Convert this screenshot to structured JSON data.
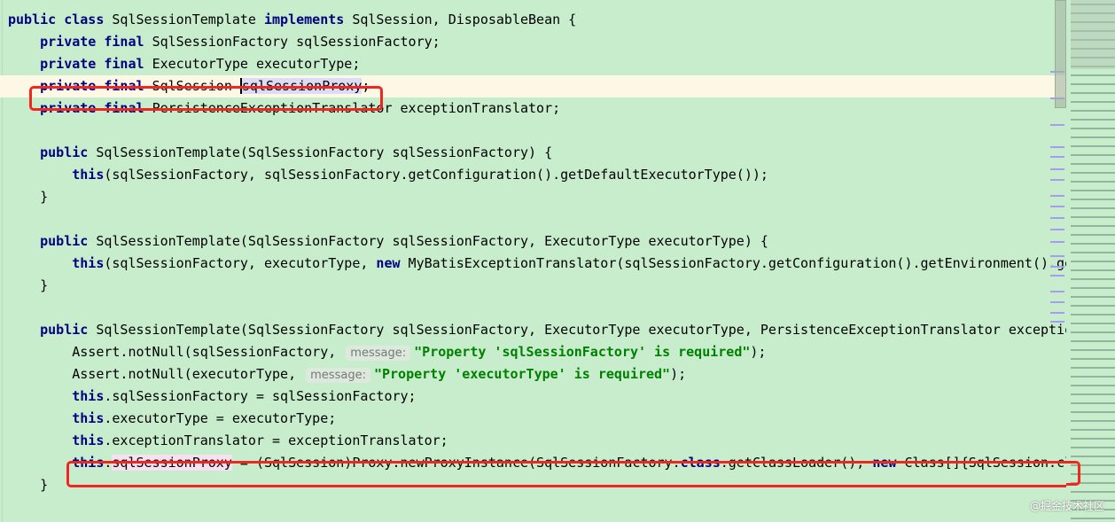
{
  "code_lines": [
    [
      [
        "k",
        "public class "
      ],
      [
        "t",
        "SqlSessionTemplate "
      ],
      [
        "k",
        "implements "
      ],
      [
        "t",
        "SqlSession, DisposableBean {"
      ]
    ],
    [
      [
        "t",
        "    "
      ],
      [
        "k",
        "private final "
      ],
      [
        "t",
        "SqlSessionFactory sqlSessionFactory;"
      ]
    ],
    [
      [
        "t",
        "    "
      ],
      [
        "k",
        "private final "
      ],
      [
        "t",
        "ExecutorType executorType;"
      ]
    ],
    [
      [
        "t",
        "    "
      ],
      [
        "k",
        "private final "
      ],
      [
        "t",
        "SqlSession "
      ],
      [
        "c",
        "sqlSessionProxy"
      ],
      [
        "t",
        ";"
      ]
    ],
    [
      [
        "t",
        "    "
      ],
      [
        "k",
        "private final "
      ],
      [
        "t",
        "PersistenceExceptionTranslator exceptionTranslator;"
      ]
    ],
    [],
    [
      [
        "t",
        "    "
      ],
      [
        "k",
        "public "
      ],
      [
        "t",
        "SqlSessionTemplate(SqlSessionFactory sqlSessionFactory) {"
      ]
    ],
    [
      [
        "t",
        "        "
      ],
      [
        "k",
        "this"
      ],
      [
        "t",
        "(sqlSessionFactory, sqlSessionFactory.getConfiguration().getDefaultExecutorType());"
      ]
    ],
    [
      [
        "t",
        "    }"
      ]
    ],
    [],
    [
      [
        "t",
        "    "
      ],
      [
        "k",
        "public "
      ],
      [
        "t",
        "SqlSessionTemplate(SqlSessionFactory sqlSessionFactory, ExecutorType executorType) {"
      ]
    ],
    [
      [
        "t",
        "        "
      ],
      [
        "k",
        "this"
      ],
      [
        "t",
        "(sqlSessionFactory, executorType, "
      ],
      [
        "k",
        "new "
      ],
      [
        "t",
        "MyBatisExceptionTranslator(sqlSessionFactory.getConfiguration().getEnvironment().getDataSource(), true));"
      ]
    ],
    [
      [
        "t",
        "    }"
      ]
    ],
    [],
    [
      [
        "t",
        "    "
      ],
      [
        "k",
        "public "
      ],
      [
        "t",
        "SqlSessionTemplate(SqlSessionFactory sqlSessionFactory, ExecutorType executorType, PersistenceExceptionTranslator exceptionTranslator) {"
      ]
    ],
    [
      [
        "t",
        "        Assert.notNull(sqlSessionFactory, "
      ],
      [
        "h",
        "message:"
      ],
      [
        "s",
        "\"Property 'sqlSessionFactory' is required\""
      ],
      [
        "t",
        ");"
      ]
    ],
    [
      [
        "t",
        "        Assert.notNull(executorType, "
      ],
      [
        "h",
        "message:"
      ],
      [
        "s",
        "\"Property 'executorType' is required\""
      ],
      [
        "t",
        ");"
      ]
    ],
    [
      [
        "t",
        "        "
      ],
      [
        "k",
        "this"
      ],
      [
        "t",
        ".sqlSessionFactory = sqlSessionFactory;"
      ]
    ],
    [
      [
        "t",
        "        "
      ],
      [
        "k",
        "this"
      ],
      [
        "t",
        ".executorType = executorType;"
      ]
    ],
    [
      [
        "t",
        "        "
      ],
      [
        "k",
        "this"
      ],
      [
        "t",
        ".exceptionTranslator = exceptionTranslator;"
      ]
    ],
    [
      [
        "t",
        "        "
      ],
      [
        "k",
        "this"
      ],
      [
        "t",
        "."
      ],
      [
        "p",
        "sqlSessionProxy"
      ],
      [
        "t",
        " = (SqlSession)Proxy.newProxyInstance(SqlSessionFactory."
      ],
      [
        "k",
        "class"
      ],
      [
        "t",
        ".getClassLoader(), "
      ],
      [
        "k",
        "new "
      ],
      [
        "t",
        "Class[]{SqlSession.class}, new SqlSessionInterceptor());"
      ]
    ],
    [
      [
        "t",
        "    }"
      ]
    ]
  ],
  "current_line": 3,
  "colors": {
    "background": "#c7edcc",
    "keyword": "#000080",
    "string": "#008000",
    "highlight_box": "#f0271f",
    "current_line": "#fdf8e6"
  },
  "watermark": "@掘金技术社区"
}
